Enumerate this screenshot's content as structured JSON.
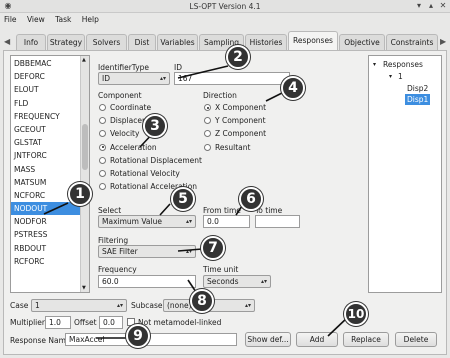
{
  "window": {
    "title": "LS-OPT Version 4.1"
  },
  "menu": [
    "File",
    "View",
    "Task",
    "Help"
  ],
  "tabs": [
    "Info",
    "Strategy",
    "Solvers",
    "Dist",
    "Variables",
    "Sampling",
    "Histories",
    "Responses",
    "Objective",
    "Constraints"
  ],
  "active_tab": "Responses",
  "component_list": {
    "items": [
      "DBBEMAC",
      "DEFORC",
      "ELOUT",
      "FLD",
      "FREQUENCY",
      "GCEOUT",
      "GLSTAT",
      "JNTFORC",
      "MASS",
      "MATSUM",
      "NCFORC",
      "NODOUT",
      "NODFOR",
      "PSTRESS",
      "RBDOUT",
      "RCFORC"
    ],
    "selected": "NODOUT"
  },
  "identifier": {
    "label": "IdentifierType",
    "value": "ID"
  },
  "id_field": {
    "label": "ID",
    "value": "167"
  },
  "component": {
    "label": "Component",
    "options": [
      "Coordinate",
      "Displacement",
      "Velocity",
      "Acceleration",
      "Rotational Displacement",
      "Rotational Velocity",
      "Rotational Acceleration"
    ],
    "selected": "Acceleration"
  },
  "direction": {
    "label": "Direction",
    "options": [
      "X Component",
      "Y Component",
      "Z Component",
      "Resultant"
    ],
    "selected": "X Component"
  },
  "select": {
    "label": "Select",
    "value": "Maximum Value"
  },
  "from_time": {
    "label": "From time",
    "value": "0.0"
  },
  "to_time": {
    "label": "To time",
    "value": ""
  },
  "filtering": {
    "label": "Filtering",
    "value": "SAE Filter"
  },
  "frequency": {
    "label": "Frequency",
    "value": "60.0"
  },
  "time_unit": {
    "label": "Time unit",
    "value": "Seconds"
  },
  "case": {
    "label": "Case",
    "value": "1"
  },
  "subcase": {
    "label": "Subcase",
    "value": "(none)"
  },
  "multiplier": {
    "label": "Multiplier",
    "value": "1.0"
  },
  "offset": {
    "label": "Offset",
    "value": "0.0"
  },
  "not_metamodel": {
    "label": "Not metamodel-linked",
    "checked": false
  },
  "response_name": {
    "label": "Response Name",
    "value": "MaxAccel"
  },
  "buttons": {
    "show_def": "Show def...",
    "add": "Add",
    "replace": "Replace",
    "delete": "Delete"
  },
  "tree": {
    "root": "Responses",
    "case": "1",
    "items": [
      "Disp2",
      "Disp1"
    ],
    "selected": "Disp1"
  },
  "callouts": [
    "1",
    "2",
    "3",
    "4",
    "5",
    "6",
    "7",
    "8",
    "9",
    "10"
  ]
}
